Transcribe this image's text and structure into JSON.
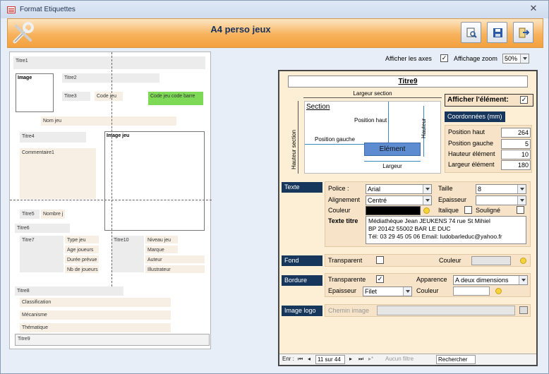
{
  "window": {
    "title": "Format Etiquettes"
  },
  "header": {
    "title": "A4 perso jeux"
  },
  "options": {
    "axes_label": "Afficher les axes",
    "axes_checked": "✓",
    "zoom_label": "Affichage zoom",
    "zoom_value": "50%"
  },
  "preview": {
    "titre1": "Titre1",
    "image": "Image",
    "titre2": "Titre2",
    "titre3": "Titre3",
    "code_jeu": "Code jeu",
    "code_barre": "Code jeu code barre",
    "nom_jeu": "Nom jeu",
    "titre4": "Titre4",
    "image_jeu": "Image jeu",
    "commentaire1": "Commentaire1",
    "titre5": "Titre5",
    "nombre": "Nombre j",
    "titre6": "Titre6",
    "titre7": "Titre7",
    "type_jeu": "Type jeu",
    "age_joueurs": "Age joueurs",
    "duree": "Durée prévue",
    "nb_joueurs": "Nb de joueurs",
    "titre10": "Titre10",
    "niveau_jeu": "Niveau jeu",
    "marque": "Marque",
    "auteur": "Auteur",
    "illustrateur": "Illustrateur",
    "titre8": "Titre8",
    "classification": "Classification",
    "mecanisme": "Mécanisme",
    "thematique": "Thématique",
    "titre9": "Titre9"
  },
  "panel": {
    "element_title": "Titre9",
    "diagram": {
      "largeur_section": "Largeur section",
      "section": "Section",
      "position_haut": "Position haut",
      "hauteur": "Hauteur",
      "hauteur_section": "Hauteur section",
      "position_gauche": "Position gauche",
      "element": "Elément",
      "largeur": "Largeur"
    },
    "afficher_label": "Afficher l'élément:",
    "afficher_checked": "✓",
    "coords_header": "Coordonnées  (mm)",
    "coords": [
      {
        "label": "Position haut",
        "value": "264"
      },
      {
        "label": "Position gauche",
        "value": "5"
      },
      {
        "label": "Hauteur élément",
        "value": "10"
      },
      {
        "label": "Largeur élément",
        "value": "180"
      }
    ],
    "texte": {
      "header": "Texte",
      "police_label": "Police :",
      "police_value": "Arial",
      "taille_label": "Taille",
      "taille_value": "8",
      "alignement_label": "Alignement",
      "alignement_value": "Centré",
      "epaisseur_label": "Epaisseur",
      "epaisseur_value": "",
      "couleur_label": "Couleur",
      "italique_label": "Italique",
      "souligne_label": "Souligné",
      "texte_titre_label": "Texte titre",
      "texte_titre_lines": [
        "Médiathèque Jean JEUKENS  74 rue St Mihiel",
        "BP 20142   55002 BAR LE DUC",
        "Tél: 03 29 45 05 06   Email: ludobarleduc@yahoo.fr"
      ]
    },
    "fond": {
      "header": "Fond",
      "transparent_label": "Transparent",
      "couleur_label": "Couleur"
    },
    "bordure": {
      "header": "Bordure",
      "transparente_label": "Transparente",
      "transparente_checked": "✓",
      "apparence_label": "Apparence",
      "apparence_value": "A deux dimensions",
      "epaisseur_label": "Epaisseur",
      "epaisseur_value": "Filet",
      "couleur_label": "Couleur"
    },
    "logo": {
      "header": "Image logo",
      "chemin_label": "Chemin image"
    },
    "nav": {
      "enr_label": "Enr :",
      "position": "11 sur 44",
      "filter": "Aucun filtre",
      "search": "Rechercher"
    }
  },
  "colors": {
    "accent": "#16365c",
    "header_orange": "#f7b25c",
    "panel_bg": "#fcefd6",
    "code_barre_green": "#7ed957"
  }
}
